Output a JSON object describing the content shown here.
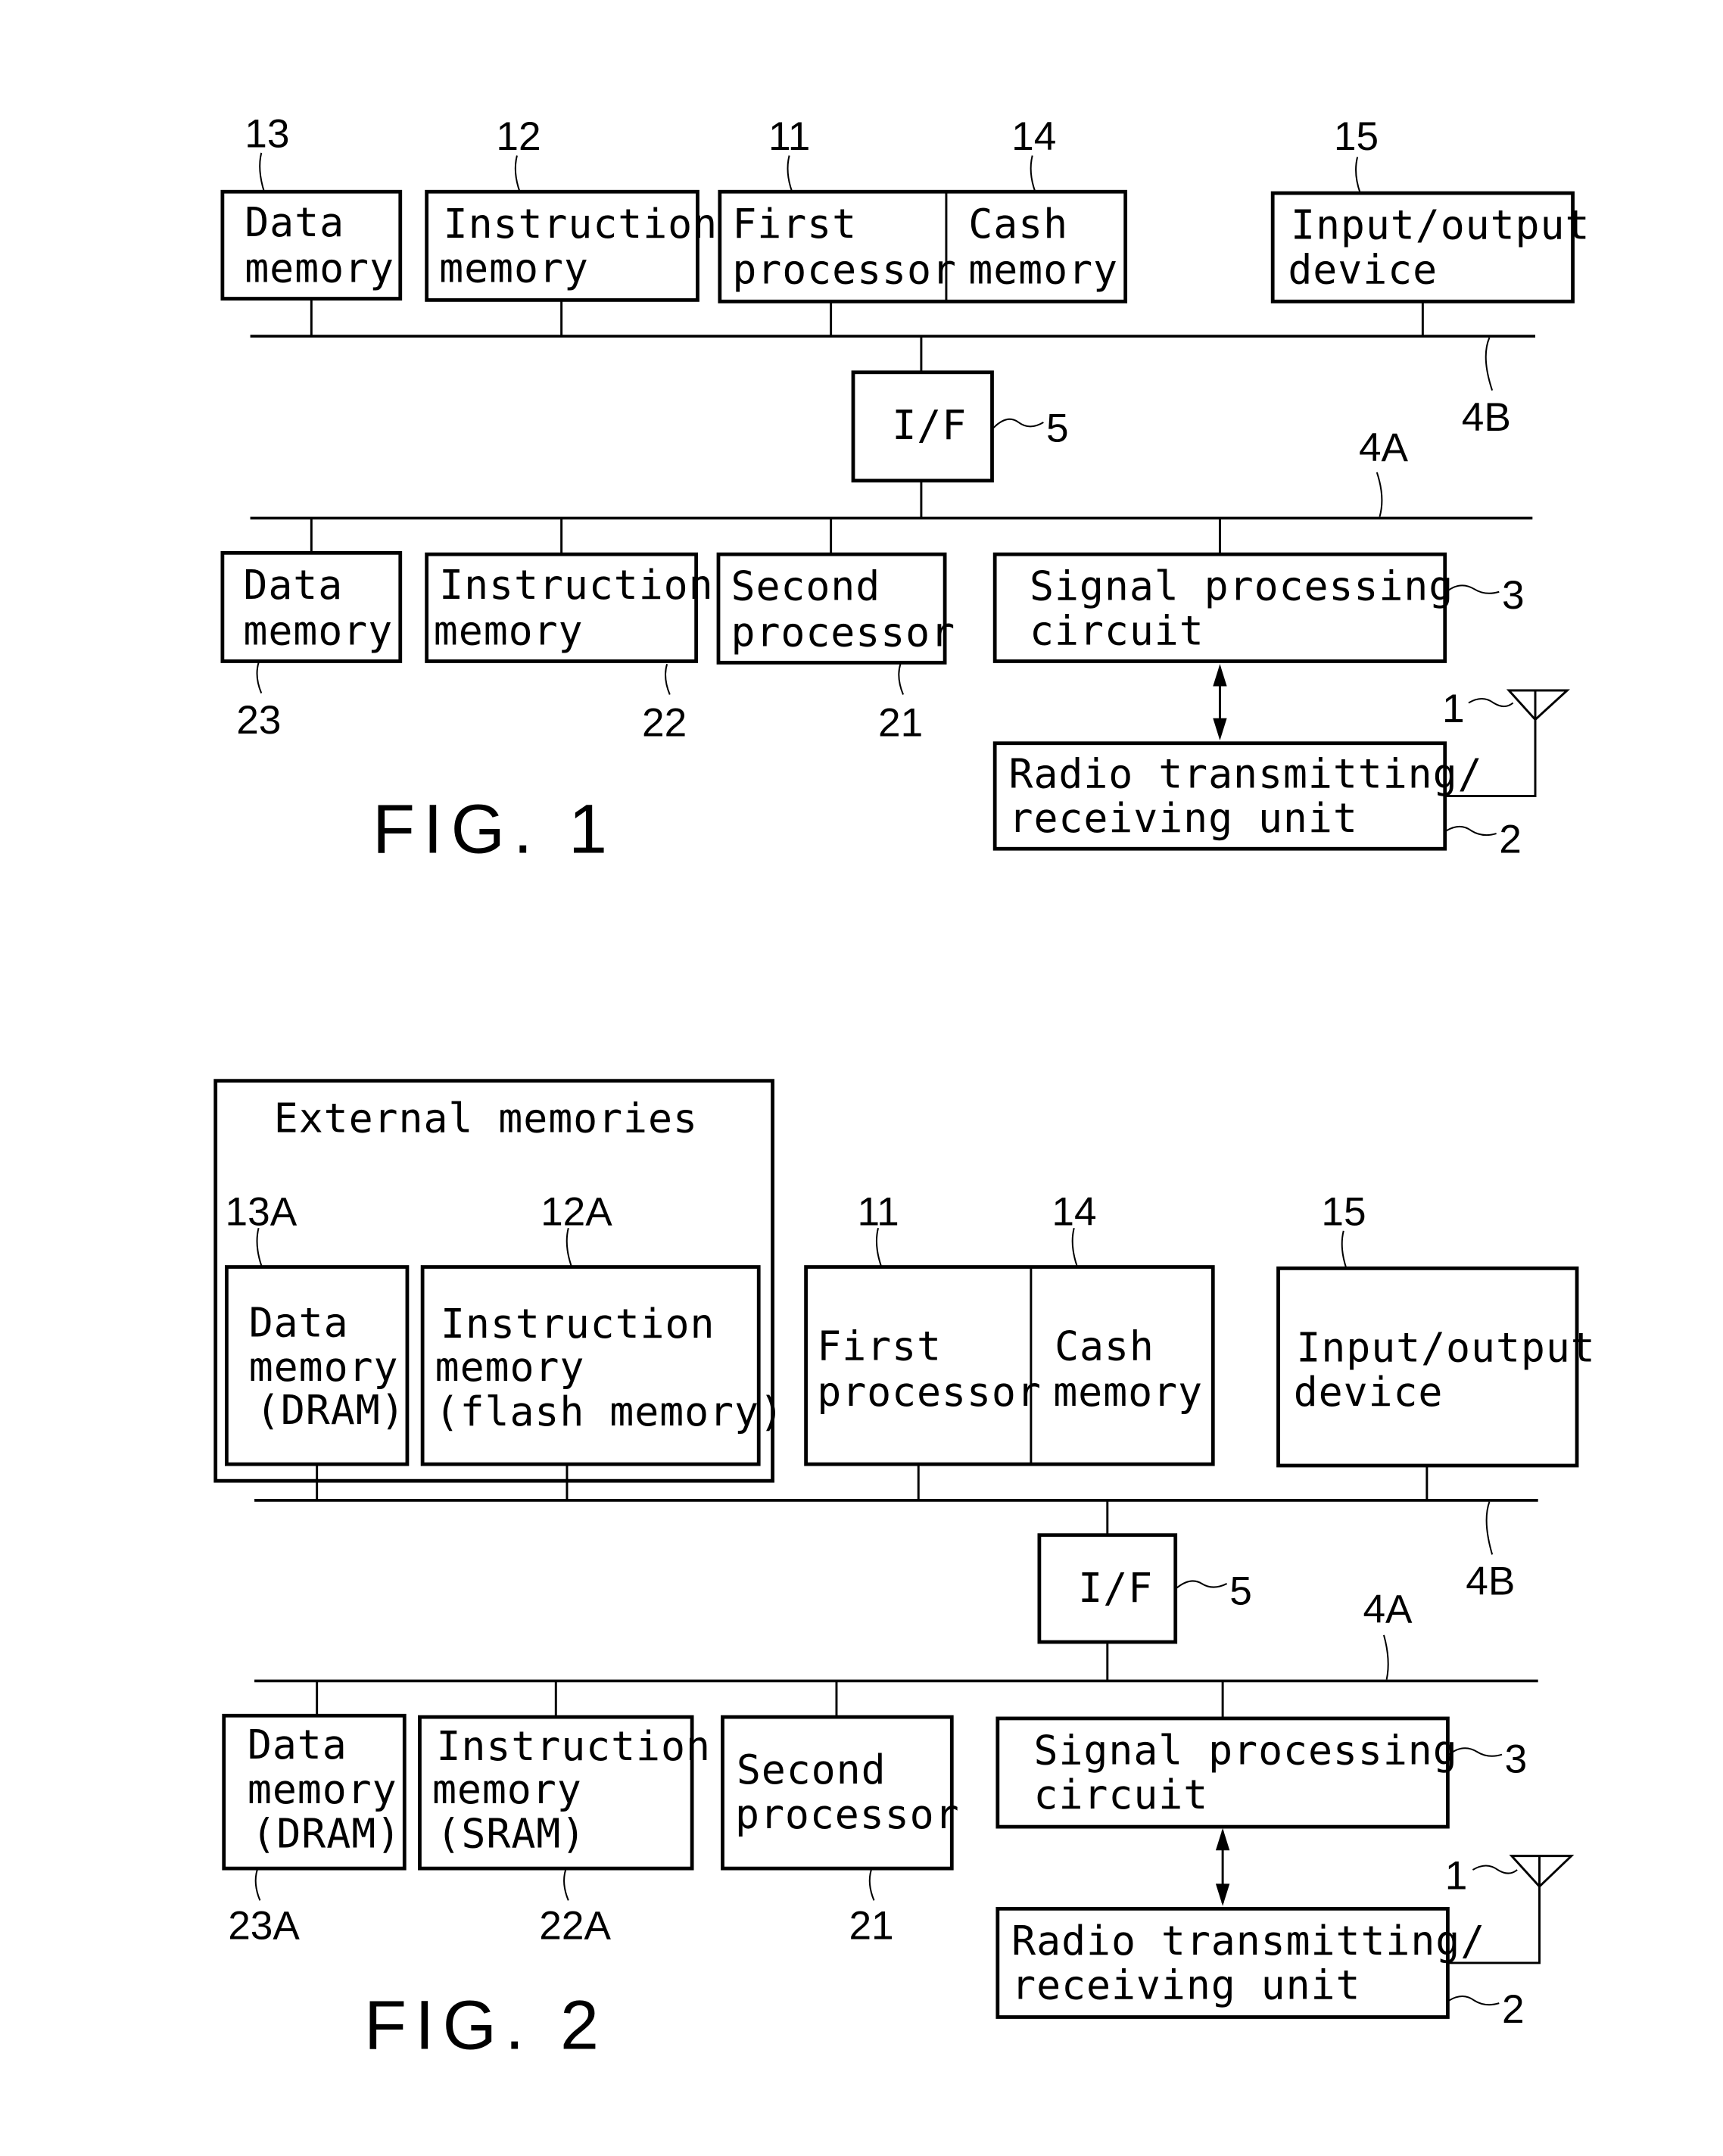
{
  "fig1": {
    "caption": "FIG. 1",
    "bus_upper": "4B",
    "bus_lower": "4A",
    "blocks": {
      "data_memory": {
        "ref": "13",
        "line1": "Data",
        "line2": "memory"
      },
      "instruction_memory": {
        "ref": "12",
        "line1": "Instruction",
        "line2": "memory"
      },
      "first_processor": {
        "ref": "11",
        "line1": "First",
        "line2": "processor"
      },
      "cash_memory": {
        "ref": "14",
        "line1": "Cash",
        "line2": "memory"
      },
      "io_device": {
        "ref": "15",
        "line1": "Input/output",
        "line2": "device"
      },
      "interface": {
        "ref": "5",
        "line1": "I/F"
      },
      "data_memory_2": {
        "ref": "23",
        "line1": "Data",
        "line2": "memory"
      },
      "instruction_memory_2": {
        "ref": "22",
        "line1": "Instruction",
        "line2": "memory"
      },
      "second_processor": {
        "ref": "21",
        "line1": "Second",
        "line2": "processor"
      },
      "signal_processing": {
        "ref": "3",
        "line1": "Signal processing",
        "line2": "circuit"
      },
      "radio_unit": {
        "ref": "2",
        "line1": "Radio transmitting/",
        "line2": "receiving unit"
      },
      "antenna": {
        "ref": "1"
      }
    }
  },
  "fig2": {
    "caption": "FIG. 2",
    "bus_upper": "4B",
    "bus_lower": "4A",
    "external_group_title": "External memories",
    "blocks": {
      "data_memory": {
        "ref": "13A",
        "line1": "Data",
        "line2": "memory",
        "line3": "(DRAM)"
      },
      "instruction_memory": {
        "ref": "12A",
        "line1": "Instruction",
        "line2": "memory",
        "line3": "(flash memory)"
      },
      "first_processor": {
        "ref": "11",
        "line1": "First",
        "line2": "processor"
      },
      "cash_memory": {
        "ref": "14",
        "line1": "Cash",
        "line2": "memory"
      },
      "io_device": {
        "ref": "15",
        "line1": "Input/output",
        "line2": "device"
      },
      "interface": {
        "ref": "5",
        "line1": "I/F"
      },
      "data_memory_2": {
        "ref": "23A",
        "line1": "Data",
        "line2": "memory",
        "line3": "(DRAM)"
      },
      "instruction_memory_2": {
        "ref": "22A",
        "line1": "Instruction",
        "line2": "memory",
        "line3": "(SRAM)"
      },
      "second_processor": {
        "ref": "21",
        "line1": "Second",
        "line2": "processor"
      },
      "signal_processing": {
        "ref": "3",
        "line1": "Signal processing",
        "line2": "circuit"
      },
      "radio_unit": {
        "ref": "2",
        "line1": "Radio transmitting/",
        "line2": "receiving unit"
      },
      "antenna": {
        "ref": "1"
      }
    }
  }
}
